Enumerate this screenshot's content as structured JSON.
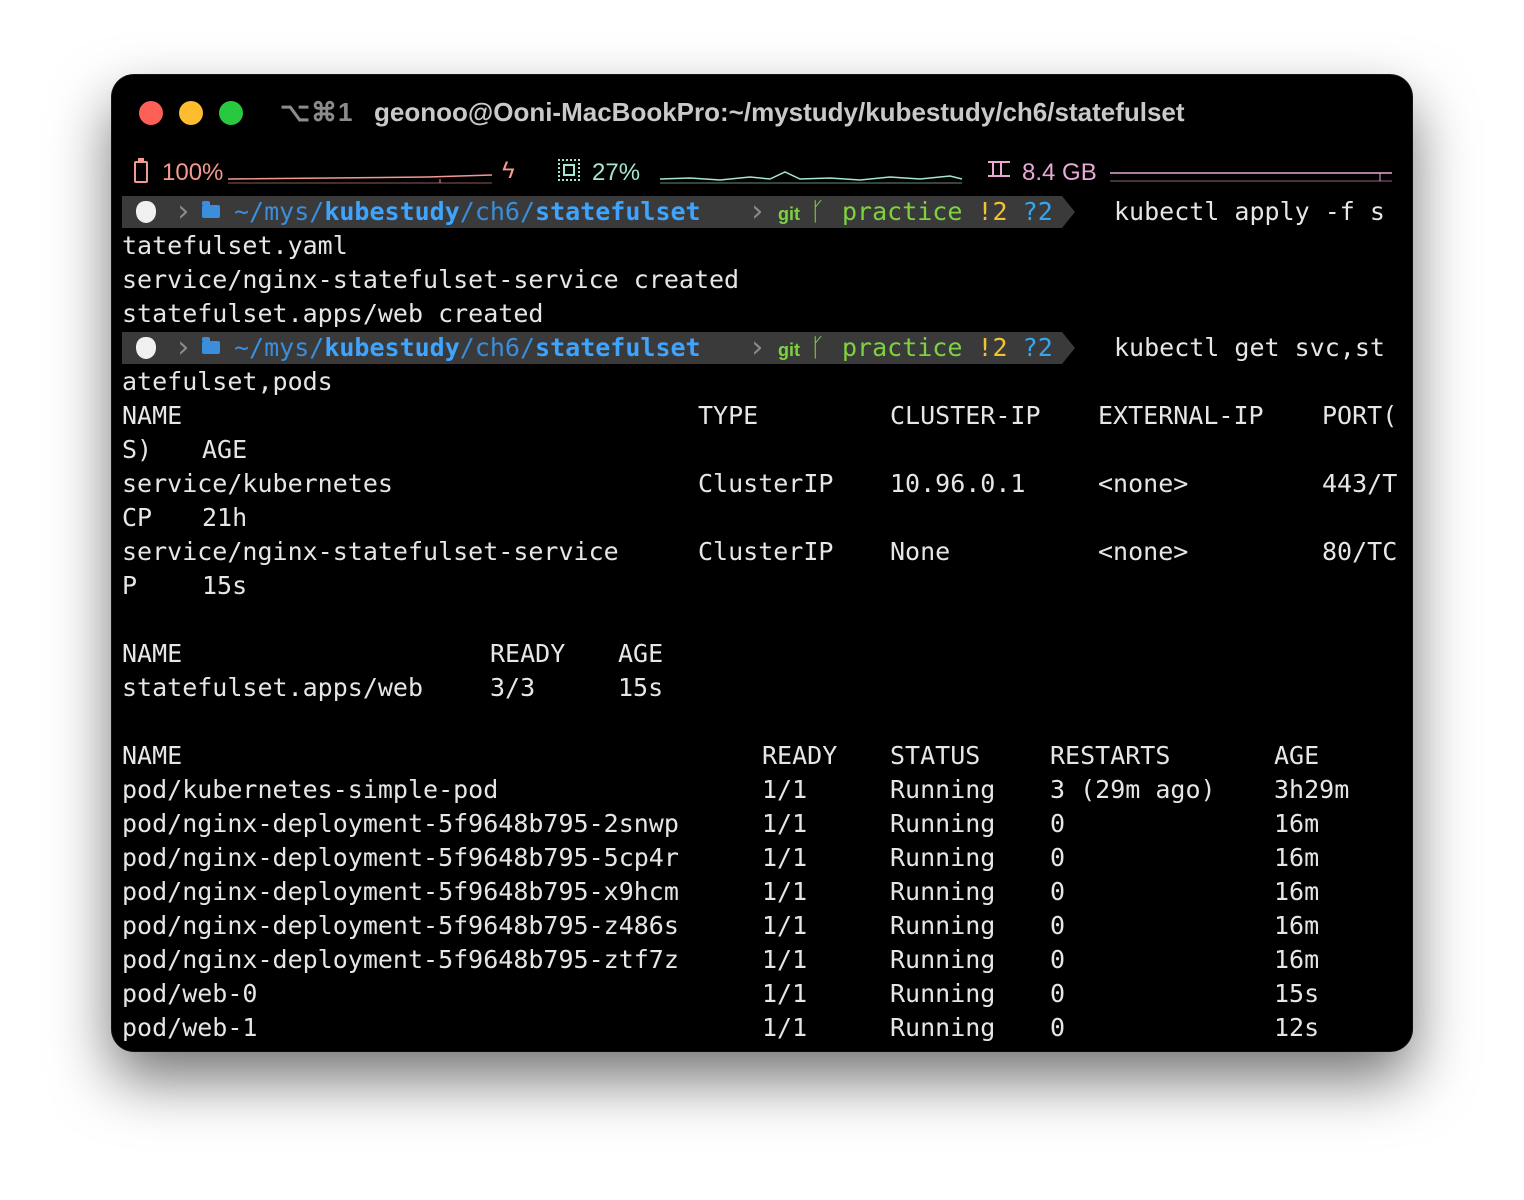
{
  "window": {
    "shortcut": "⌥⌘1",
    "title": "geonoo@Ooni-MacBookPro:~/mystudy/kubestudy/ch6/statefulset"
  },
  "statusbar": {
    "battery": "100%",
    "cpu": "27%",
    "memory": "8.4 GB",
    "icons": [
      "battery-icon",
      "charging-bolt-icon",
      "cpu-icon",
      "memory-icon"
    ],
    "colors": {
      "battery": "#f29a8e",
      "cpu": "#a5e6cf",
      "memory": "#e9a9d7"
    }
  },
  "prompt": {
    "path_prefix": "~/mys/",
    "path_repo": "kubestudy",
    "path_mid": "/ch6/",
    "path_leaf": "statefulset",
    "git_label": "git",
    "branch": "practice",
    "modified": "!2",
    "untracked": "?2"
  },
  "commands": [
    {
      "cmd_part1": "kubectl apply -f s",
      "cmd_part2": "tatefulset.yaml"
    },
    {
      "cmd_part1": "kubectl get svc,st",
      "cmd_part2": "atefulset,pods"
    }
  ],
  "apply_output": [
    "service/nginx-statefulset-service created",
    "statefulset.apps/web created"
  ],
  "svc_table": {
    "headers": [
      "NAME",
      "TYPE",
      "CLUSTER-IP",
      "EXTERNAL-IP",
      "PORT(",
      "S)",
      "AGE"
    ],
    "rows": [
      {
        "name": "service/kubernetes",
        "type": "ClusterIP",
        "cluster_ip": "10.96.0.1",
        "external_ip": "<none>",
        "port_a": "443/T",
        "port_b": "CP",
        "age": "21h"
      },
      {
        "name": "service/nginx-statefulset-service",
        "type": "ClusterIP",
        "cluster_ip": "None",
        "external_ip": "<none>",
        "port_a": "80/TC",
        "port_b": "P",
        "age": "15s"
      }
    ]
  },
  "sts_table": {
    "headers": [
      "NAME",
      "READY",
      "AGE"
    ],
    "rows": [
      {
        "name": "statefulset.apps/web",
        "ready": "3/3",
        "age": "15s"
      }
    ]
  },
  "pods_table": {
    "headers": [
      "NAME",
      "READY",
      "STATUS",
      "RESTARTS",
      "AGE"
    ],
    "rows": [
      {
        "name": "pod/kubernetes-simple-pod",
        "ready": "1/1",
        "status": "Running",
        "restarts": "3 (29m ago)",
        "age": "3h29m"
      },
      {
        "name": "pod/nginx-deployment-5f9648b795-2snwp",
        "ready": "1/1",
        "status": "Running",
        "restarts": "0",
        "age": "16m"
      },
      {
        "name": "pod/nginx-deployment-5f9648b795-5cp4r",
        "ready": "1/1",
        "status": "Running",
        "restarts": "0",
        "age": "16m"
      },
      {
        "name": "pod/nginx-deployment-5f9648b795-x9hcm",
        "ready": "1/1",
        "status": "Running",
        "restarts": "0",
        "age": "16m"
      },
      {
        "name": "pod/nginx-deployment-5f9648b795-z486s",
        "ready": "1/1",
        "status": "Running",
        "restarts": "0",
        "age": "16m"
      },
      {
        "name": "pod/nginx-deployment-5f9648b795-ztf7z",
        "ready": "1/1",
        "status": "Running",
        "restarts": "0",
        "age": "16m"
      },
      {
        "name": "pod/web-0",
        "ready": "1/1",
        "status": "Running",
        "restarts": "0",
        "age": "15s"
      },
      {
        "name": "pod/web-1",
        "ready": "1/1",
        "status": "Running",
        "restarts": "0",
        "age": "12s"
      }
    ]
  }
}
